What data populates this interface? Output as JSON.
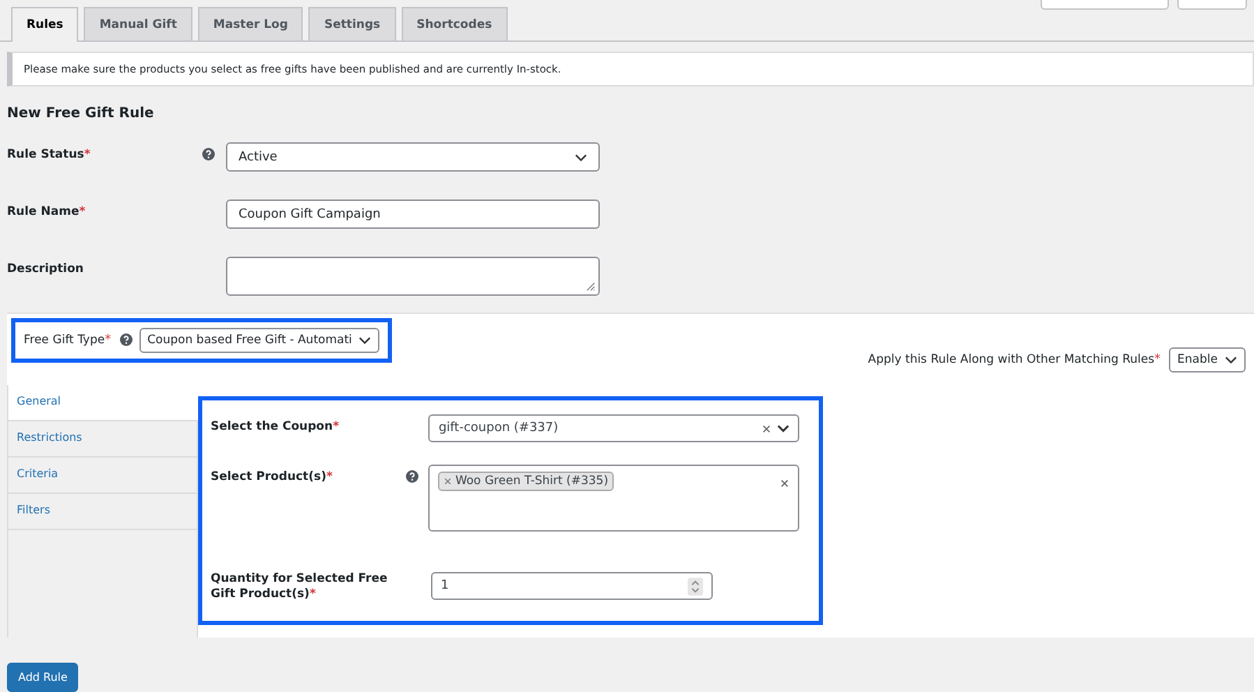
{
  "tabs": [
    {
      "label": "Rules",
      "selected": true
    },
    {
      "label": "Manual Gift",
      "selected": false
    },
    {
      "label": "Master Log",
      "selected": false
    },
    {
      "label": "Settings",
      "selected": false
    },
    {
      "label": "Shortcodes",
      "selected": false
    }
  ],
  "notice": "Please make sure the products you select as free gifts have been published and are currently In-stock.",
  "heading": "New Free Gift Rule",
  "fields": [
    {
      "label": "Rule Status",
      "required_mark": "*",
      "help": true,
      "kind": "select",
      "value": "Active"
    },
    {
      "label": "Rule Name",
      "required_mark": "*",
      "kind": "text",
      "value": "Coupon Gift Campaign"
    },
    {
      "label": "Description",
      "kind": "textarea"
    }
  ],
  "type_bar": {
    "highlighted": true,
    "label": "Free Gift Type",
    "required_mark": "*",
    "help": true,
    "value": "Coupon based Free Gift - Automati",
    "apply_label": "Apply this Rule Along with Other Matching Rules",
    "apply_required_mark": "*",
    "apply_value": "Enable"
  },
  "side_tabs": [
    {
      "label": "General",
      "selected": true
    },
    {
      "label": "Restrictions",
      "selected": false
    },
    {
      "label": "Criteria",
      "selected": false
    },
    {
      "label": "Filters",
      "selected": false
    }
  ],
  "panel": {
    "highlighted": true,
    "fields": [
      {
        "label": "Select the Coupon",
        "required_mark": "*",
        "kind": "select",
        "value": "gift-coupon (#337)",
        "clearable": true
      },
      {
        "label": "Select Product(s)",
        "required_mark": "*",
        "help": true,
        "kind": "multiselect",
        "tags": [
          "Woo Green T-Shirt (#335)"
        ],
        "clearable": true
      },
      {
        "label": "Quantity for Selected Free Gift Product(s)",
        "required_mark": "*",
        "kind": "number",
        "value": "1"
      }
    ]
  },
  "button": "Add Rule"
}
